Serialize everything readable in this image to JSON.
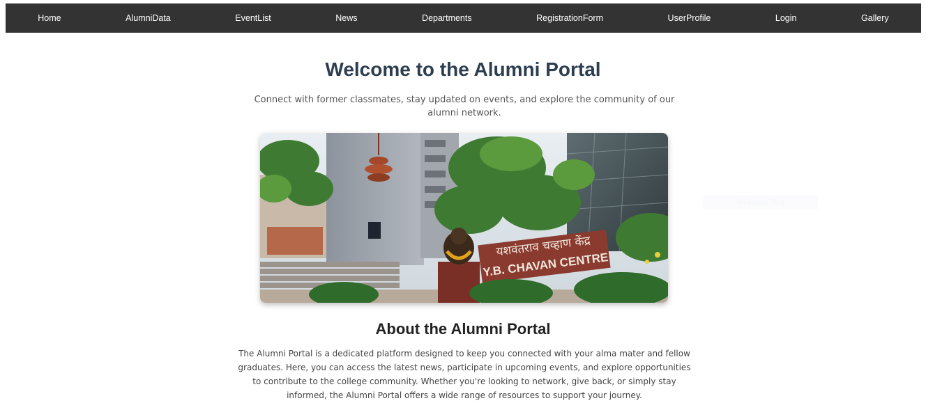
{
  "nav": {
    "items": [
      {
        "label": "Home"
      },
      {
        "label": "AlumniData"
      },
      {
        "label": "EventList"
      },
      {
        "label": "News"
      },
      {
        "label": "Departments"
      },
      {
        "label": "RegistrationForm"
      },
      {
        "label": "UserProfile"
      },
      {
        "label": "Login"
      },
      {
        "label": "Gallery"
      }
    ]
  },
  "hero": {
    "title": "Welcome to the Alumni Portal",
    "subtitle": "Connect with former classmates, stay updated on events, and explore the community of our alumni network.",
    "image": {
      "sign_devanagari": "यशवंतराव चव्हाण केंद्र",
      "sign_english": "Y.B. CHAVAN CENTRE"
    }
  },
  "faint_label": "Welcome Text",
  "about": {
    "title": "About the Alumni Portal",
    "text": "The Alumni Portal is a dedicated platform designed to keep you connected with your alma mater and fellow graduates. Here, you can access the latest news, participate in upcoming events, and explore opportunities to contribute to the college community. Whether you're looking to network, give back, or simply stay informed, the Alumni Portal offers a wide range of resources to support your journey."
  },
  "colors": {
    "nav_bg": "#333333",
    "title": "#2c3e50"
  }
}
